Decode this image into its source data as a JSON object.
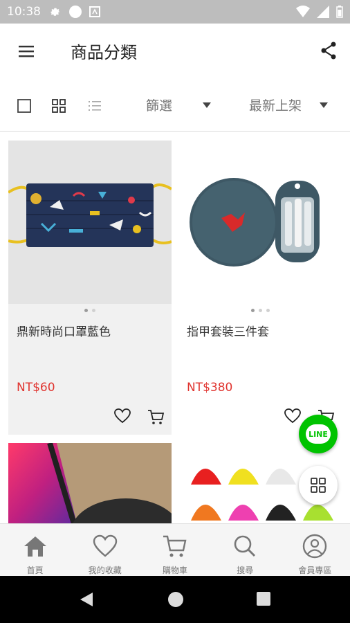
{
  "status_bar": {
    "time": "10:38"
  },
  "app_bar": {
    "title": "商品分類"
  },
  "toolbar": {
    "filter_label": "篩選",
    "sort_label": "最新上架"
  },
  "products": [
    {
      "name": "鼎新時尚口罩藍色",
      "price": "NT$60"
    },
    {
      "name": "指甲套裝三件套",
      "price": "NT$380"
    }
  ],
  "line_button": {
    "label": "LINE"
  },
  "bottom_nav": {
    "items": [
      {
        "label": "首頁",
        "icon": "home-icon"
      },
      {
        "label": "我的收藏",
        "icon": "heart-icon"
      },
      {
        "label": "購物車",
        "icon": "cart-icon"
      },
      {
        "label": "搜尋",
        "icon": "search-icon"
      },
      {
        "label": "會員專區",
        "icon": "user-icon"
      }
    ]
  },
  "colors": {
    "price": "#e0342f",
    "line_green": "#00c300",
    "status_bar": "#bdbdbd"
  }
}
